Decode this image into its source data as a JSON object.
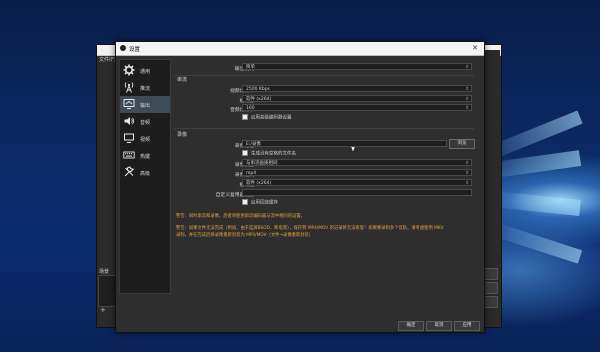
{
  "dialog": {
    "title": "设置",
    "close_label": "✕"
  },
  "sidebar": {
    "items": [
      {
        "label": "通用",
        "icon": "gear-icon"
      },
      {
        "label": "推流",
        "icon": "broadcast-tower-icon"
      },
      {
        "label": "输出",
        "icon": "output-monitor-icon",
        "active": true
      },
      {
        "label": "音频",
        "icon": "speaker-icon"
      },
      {
        "label": "视频",
        "icon": "display-icon"
      },
      {
        "label": "热键",
        "icon": "keyboard-icon"
      },
      {
        "label": "高级",
        "icon": "tools-icon"
      }
    ]
  },
  "output": {
    "mode_label": "输出模式",
    "mode_value": "简单",
    "streaming_section": "串流",
    "video_bitrate_label": "视频比特率",
    "video_bitrate_value": "2500 Kbps",
    "encoder_label": "编码器",
    "encoder_value": "软件 (x264)",
    "audio_bitrate_label": "音频比特率",
    "audio_bitrate_value": "160",
    "advanced_encoder_check": "启用高级编码器设置",
    "recording_section": "录像",
    "record_path_label": "录像路径",
    "record_path_value": "E:/录像",
    "browse_label": "浏览",
    "no_space_check": "生成没有空格的文件名",
    "record_quality_label": "录像质量",
    "record_quality_value": "与串流画质相同",
    "record_format_label": "录像格式",
    "record_format_value": "mp4",
    "record_encoder_label": "编码器",
    "record_encoder_value": "软件 (x264)",
    "custom_muxer_label": "自定义复用器设置",
    "custom_muxer_value": "",
    "replay_buffer_check": "启用回放缓存"
  },
  "warnings": {
    "line1": "警告：同时串流和录像，后者将使用串流编码器与流中相同的设置。",
    "line2": "警告：如果文件无法完成（例如，由于蓝屏BSOD、断电等），保存到 MP4/MOV 的记录将无法恢复！如果要录制多个音轨，请考虑使用 MKV",
    "line3": "录制，并在完成后将录像重新封装为 MP4/MOV（文件→录像重新封装）"
  },
  "buttons": {
    "ok": "确定",
    "cancel": "取消",
    "apply": "应用"
  },
  "background_window": {
    "menu_text": "文件(F)",
    "scenes_label": "场景",
    "add_label": "+"
  }
}
